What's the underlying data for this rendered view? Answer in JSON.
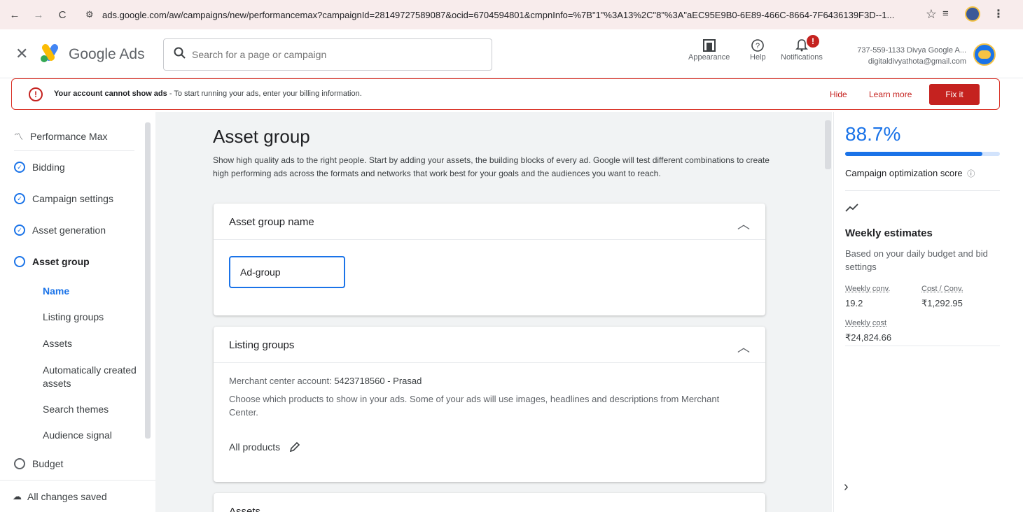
{
  "browser": {
    "url": "ads.google.com/aw/campaigns/new/performancemax?campaignId=28149727589087&ocid=6704594801&cmpnInfo=%7B\"1\"%3A13%2C\"8\"%3A\"aEC95E9B0-6E89-466C-8664-7F6436139F3D--1..."
  },
  "header": {
    "brand": "Google Ads",
    "search_placeholder": "Search for a page or campaign",
    "appearance_label": "Appearance",
    "help_label": "Help",
    "notifications_label": "Notifications",
    "notification_badge": "!",
    "account_line1": "737-559-1133 Divya Google A...",
    "account_line2": "digitaldivyathota@gmail.com"
  },
  "alert": {
    "title": "Your account cannot show ads",
    "message": " - To start running your ads, enter your billing information.",
    "hide_label": "Hide",
    "learn_more_label": "Learn more",
    "fix_label": "Fix it"
  },
  "sidebar": {
    "items": [
      {
        "label": "Performance Max"
      },
      {
        "label": "Bidding"
      },
      {
        "label": "Campaign settings"
      },
      {
        "label": "Asset generation"
      },
      {
        "label": "Asset group"
      }
    ],
    "subitems": [
      {
        "label": "Name"
      },
      {
        "label": "Listing groups"
      },
      {
        "label": "Assets"
      },
      {
        "label": "Automatically created assets"
      },
      {
        "label": "Search themes"
      },
      {
        "label": "Audience signal"
      }
    ],
    "budget_label": "Budget",
    "saved_label": "All changes saved"
  },
  "main": {
    "title": "Asset group",
    "description": "Show high quality ads to the right people. Start by adding your assets, the building blocks of every ad. Google will test different combinations to create high performing ads across the formats and networks that work best for your goals and the audiences you want to reach.",
    "name_card": {
      "title": "Asset group name",
      "value": "Ad-group"
    },
    "listing_card": {
      "title": "Listing groups",
      "merchant_prefix": "Merchant center account: ",
      "merchant_value": "5423718560 - Prasad",
      "info": "Choose which products to show in your ads. Some of your ads will use images, headlines and descriptions from Merchant Center.",
      "all_products": "All products"
    },
    "assets_card": {
      "title": "Assets"
    }
  },
  "right_panel": {
    "score": "88.7%",
    "score_fraction": 0.887,
    "score_label": "Campaign optimization score",
    "weekly_title": "Weekly estimates",
    "based_on": "Based on your daily budget and bid settings",
    "weekly_conv_label": "Weekly conv.",
    "weekly_conv_value": "19.2",
    "cost_conv_label": "Cost / Conv.",
    "cost_conv_value": "₹1,292.95",
    "weekly_cost_label": "Weekly cost",
    "weekly_cost_value": "₹24,824.66"
  },
  "colors": {
    "accent": "#1a73e8",
    "error": "#c5221f"
  }
}
